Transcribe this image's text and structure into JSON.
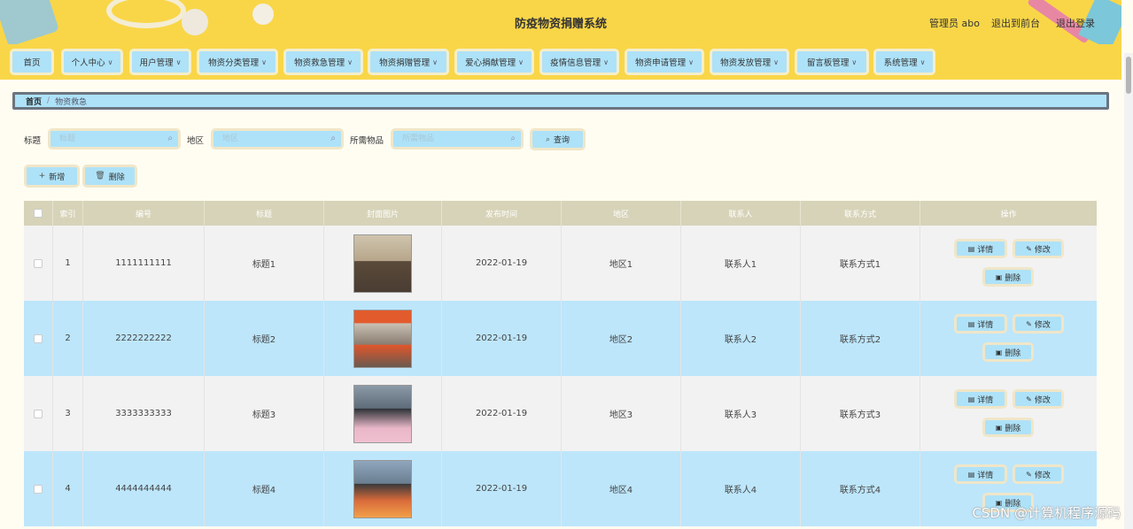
{
  "header": {
    "title": "防疫物资捐赠系统",
    "user": "管理员 abo",
    "front_link": "退出到前台",
    "logout_link": "退出登录"
  },
  "nav": [
    {
      "label": "首页",
      "dropdown": false
    },
    {
      "label": "个人中心",
      "dropdown": true
    },
    {
      "label": "用户管理",
      "dropdown": true
    },
    {
      "label": "物资分类管理",
      "dropdown": true
    },
    {
      "label": "物资救急管理",
      "dropdown": true
    },
    {
      "label": "物资捐赠管理",
      "dropdown": true
    },
    {
      "label": "爱心捐献管理",
      "dropdown": true
    },
    {
      "label": "疫情信息管理",
      "dropdown": true
    },
    {
      "label": "物资申请管理",
      "dropdown": true
    },
    {
      "label": "物资发放管理",
      "dropdown": true
    },
    {
      "label": "留言板管理",
      "dropdown": true
    },
    {
      "label": "系统管理",
      "dropdown": true
    }
  ],
  "breadcrumb": {
    "home": "首页",
    "separator": "/",
    "current": "物资救急"
  },
  "search": {
    "title_label": "标题",
    "title_placeholder": "标题",
    "region_label": "地区",
    "region_placeholder": "地区",
    "goods_label": "所需物品",
    "goods_placeholder": "所需物品",
    "query_button": "查询"
  },
  "actions": {
    "add": "新增",
    "delete": "删除"
  },
  "table": {
    "columns": [
      "索引",
      "编号",
      "标题",
      "封面图片",
      "发布时间",
      "地区",
      "联系人",
      "联系方式",
      "操作"
    ],
    "rows": [
      {
        "index": "1",
        "code": "1111111111",
        "title": "标题1",
        "date": "2022-01-19",
        "region": "地区1",
        "contact": "联系人1",
        "phone": "联系方式1"
      },
      {
        "index": "2",
        "code": "2222222222",
        "title": "标题2",
        "date": "2022-01-19",
        "region": "地区2",
        "contact": "联系人2",
        "phone": "联系方式2"
      },
      {
        "index": "3",
        "code": "3333333333",
        "title": "标题3",
        "date": "2022-01-19",
        "region": "地区3",
        "contact": "联系人3",
        "phone": "联系方式3"
      },
      {
        "index": "4",
        "code": "4444444444",
        "title": "标题4",
        "date": "2022-01-19",
        "region": "地区4",
        "contact": "联系人4",
        "phone": "联系方式4"
      }
    ],
    "row_actions": {
      "detail": "详情",
      "edit": "修改",
      "delete": "删除"
    }
  },
  "watermark": "CSDN @计算机程序源码",
  "colors": {
    "header_bg": "#f9d648",
    "button_bg": "#aee2f8",
    "row_alt": "#bde6fb",
    "table_header": "#d7d3b8"
  }
}
